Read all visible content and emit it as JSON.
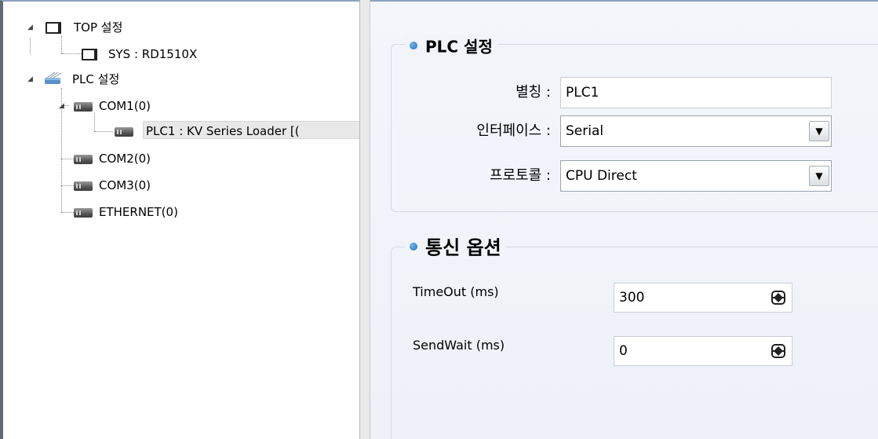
{
  "tree": {
    "items": [
      {
        "label": "TOP 설정",
        "icon": "monitor-icon"
      },
      {
        "label": "SYS : RD1510X",
        "icon": "monitor-icon"
      },
      {
        "label": "PLC 설정",
        "icon": "plc-network-icon"
      },
      {
        "label": "COM1(0)",
        "icon": "plc-device-icon"
      },
      {
        "label": "PLC1 : KV Series Loader [(",
        "icon": "plc-device-icon",
        "selected": true
      },
      {
        "label": "COM2(0)",
        "icon": "plc-device-icon"
      },
      {
        "label": "COM3(0)",
        "icon": "plc-device-icon"
      },
      {
        "label": "ETHERNET(0)",
        "icon": "plc-device-icon"
      }
    ]
  },
  "plc_settings": {
    "title": "PLC 설정",
    "alias_label": "별칭 :",
    "alias_value": "PLC1",
    "interface_label": "인터페이스 :",
    "interface_value": "Serial",
    "protocol_label": "프로토콜 :",
    "protocol_value": "CPU Direct"
  },
  "comm_options": {
    "title": "통신 옵션",
    "timeout_label": "TimeOut (ms)",
    "timeout_value": "300",
    "sendwait_label": "SendWait (ms)",
    "sendwait_value": "0"
  },
  "colors": {
    "accent_bullet": "#1f6fb5",
    "panel_background": "#eef1f7",
    "selection": "#e8e8e8"
  }
}
